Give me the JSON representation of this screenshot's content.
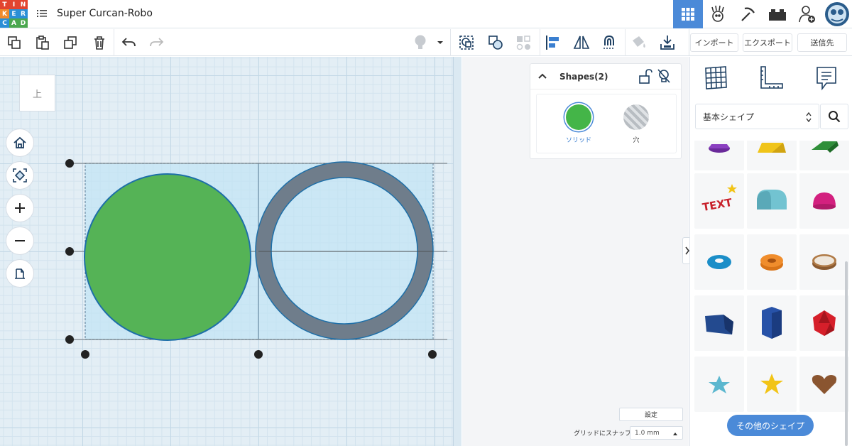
{
  "app": {
    "logo_letters": [
      "T",
      "I",
      "N",
      "K",
      "E",
      "R",
      "C",
      "A",
      "D"
    ],
    "project_title": "Super Curcan-Robo"
  },
  "toolbar": {
    "import_label": "インポート",
    "export_label": "エクスポート",
    "send_label": "送信先"
  },
  "viewcube": {
    "face_label": "上"
  },
  "shapes_panel": {
    "title": "Shapes(2)",
    "solid_label": "ソリッド",
    "hole_label": "穴",
    "solid_color": "#44b548"
  },
  "canvas_objects": {
    "cylinder_color": "#55b356",
    "tube_color": "#6f7d8b",
    "selection_color": "#bfe3f5"
  },
  "settings": {
    "settings_label": "設定",
    "snap_label": "グリッドにスナップ",
    "snap_value": "1.0 mm"
  },
  "library": {
    "category": "基本シェイプ",
    "more_shapes_label": "その他のシェイプ",
    "shapes": [
      "cone",
      "pyramid",
      "roof",
      "text",
      "half-cylinder",
      "half-sphere",
      "torus",
      "tube",
      "ring",
      "wedge-box",
      "polygon",
      "icosahedron",
      "star",
      "star-yellow",
      "heart"
    ],
    "text_shape_label": "TEXT",
    "accent": "#4b8ad8"
  }
}
